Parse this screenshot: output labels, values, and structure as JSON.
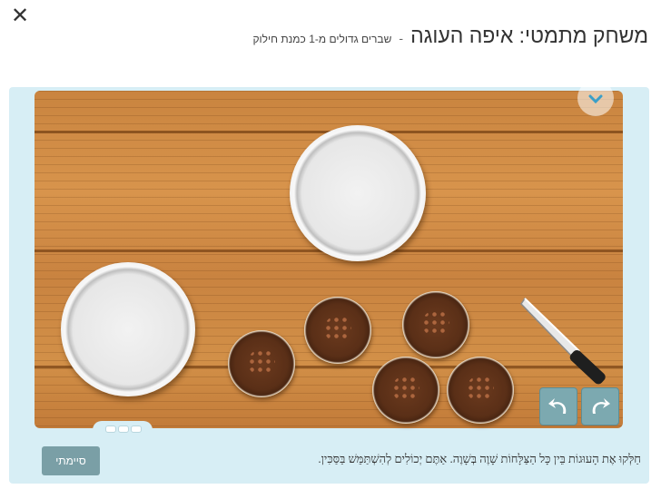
{
  "header": {
    "close_label": "✕",
    "title": "משחק מתמטי: איפה העוגה",
    "separator": "-",
    "subtitle": "שברים גדולים מ-1 כמנת חילוק"
  },
  "game": {
    "instructions": "חַלְּקוּ אֶת הָעוּגוֹת בֵּין כָּל הַצַּלָּחוֹת שָׁוֶה בְּשָׁוֶה. אַתֶּם יְכוֹלִים לְהִשְׁתַּמֵּשׁ בַּסַּכִּין.",
    "done_button_label": "סיימתי",
    "plates_count": 2,
    "cakes_count": 5,
    "icons": [
      "close-icon",
      "chevron-down-icon",
      "knife-icon",
      "undo-icon",
      "redo-icon"
    ],
    "colors": {
      "frame": "#d7eef5",
      "wood": "#c9843f",
      "button": "#7ca9b0",
      "done_button": "#7a9fa6"
    }
  }
}
